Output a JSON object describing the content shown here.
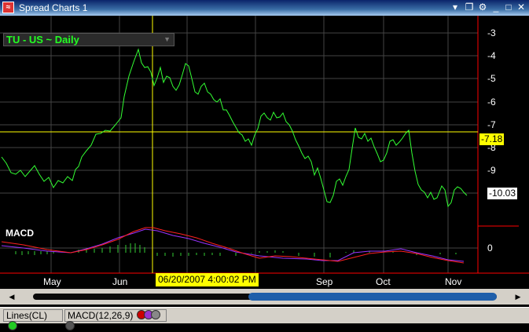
{
  "window": {
    "title": "Spread Charts 1",
    "app_icon": "chart-app-icon"
  },
  "chart": {
    "symbol": "TU - US ~ Daily",
    "price_axis_ticks": [
      "-3",
      "-4",
      "-5",
      "-6",
      "-7",
      "-8",
      "-9"
    ],
    "macd_axis_tick": "0",
    "crosshair_price_label": "-7.18",
    "last_price_label": "-10.03",
    "month_labels": [
      "May",
      "Jun",
      "Sep",
      "Oct",
      "Nov"
    ],
    "crosshair_time_label": "06/20/2007 4:00:02 PM",
    "indicator_label": "MACD",
    "colors": {
      "price": "#33ff33",
      "crosshair": "#ffff00",
      "macd_line": "#ff2020",
      "signal_line": "#9933ff",
      "histogram": "#33cc33",
      "axis": "#ff0000"
    }
  },
  "status": {
    "lines_label": "Lines(CL)",
    "lines_dot_color": "#22cc22",
    "macd_label": "MACD(12,26,9)",
    "macd_dot_colors": [
      "#cc0000",
      "#9933cc",
      "#888888",
      "#555555"
    ]
  }
}
